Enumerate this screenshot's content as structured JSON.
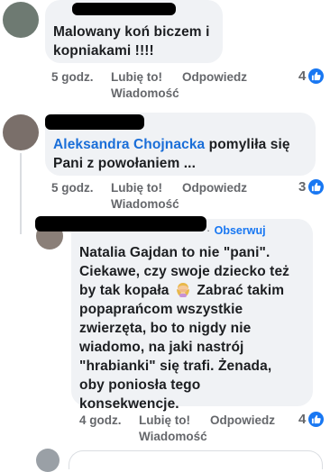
{
  "comments": [
    {
      "text_lines": [
        "Malowany koń biczem i",
        "kopniakami !!!!"
      ],
      "time": "5 godz.",
      "like": "Lubię to!",
      "reply": "Odpowiedz",
      "message": "Wiadomość",
      "reaction_count": "4"
    },
    {
      "author": "Aleksandra Chojnacka",
      "text_rest": " pomyliła się",
      "text_line2": "Pani z powołaniem ...",
      "time": "5 godz.",
      "like": "Lubię to!",
      "reply": "Odpowiedz",
      "message": "Wiadomość",
      "reaction_count": "3"
    },
    {
      "follow": "Obserwuj",
      "dot": "·",
      "text_lines": [
        "Natalia Gajdan to nie \"pani\".",
        "Ciekawe, czy swoje dziecko też",
        "by tak kopała",
        "popaprańcom wszystkie",
        "zwierzęta, bo to nigdy nie",
        "wiadomo, na jaki nastrój",
        "\"hrabianki\" się trafi. Żenada,",
        "oby poniosła tego",
        "konsekwencje."
      ],
      "text_line3_rest": "Zabrać takim",
      "time": "4 godz.",
      "like": "Lubię to!",
      "reply": "Odpowiedz",
      "message": "Wiadomość",
      "reaction_count": "4"
    }
  ],
  "colors": {
    "bubble": "#f0f2f5",
    "link": "#1a6ed8",
    "meta": "#65676b",
    "like_badge": "#1877f2"
  },
  "icons": [
    "like-reaction-icon",
    "woman-facepalming-emoji"
  ]
}
